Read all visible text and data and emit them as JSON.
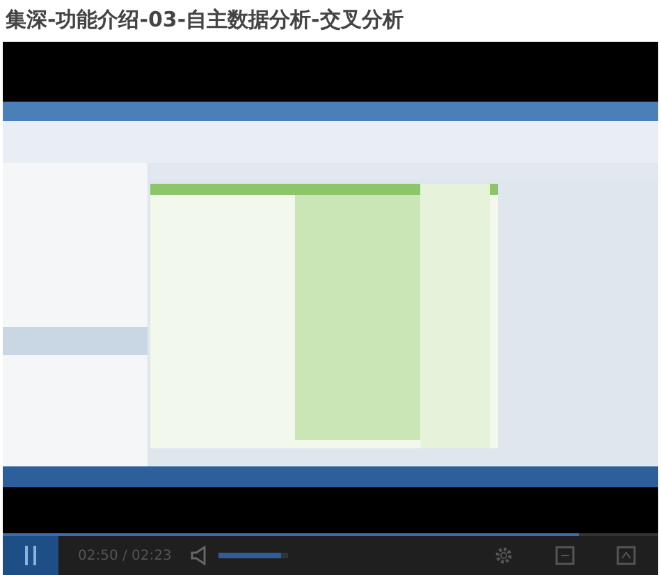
{
  "title": "集深-功能介绍-03-自主数据分析-交叉分析",
  "video": {
    "kind": "picture",
    "progress": {
      "level": 0.88
    }
  },
  "controls": {
    "playing": true,
    "time": "02:50 / 02:23",
    "volume": {
      "level": 0.9
    }
  }
}
